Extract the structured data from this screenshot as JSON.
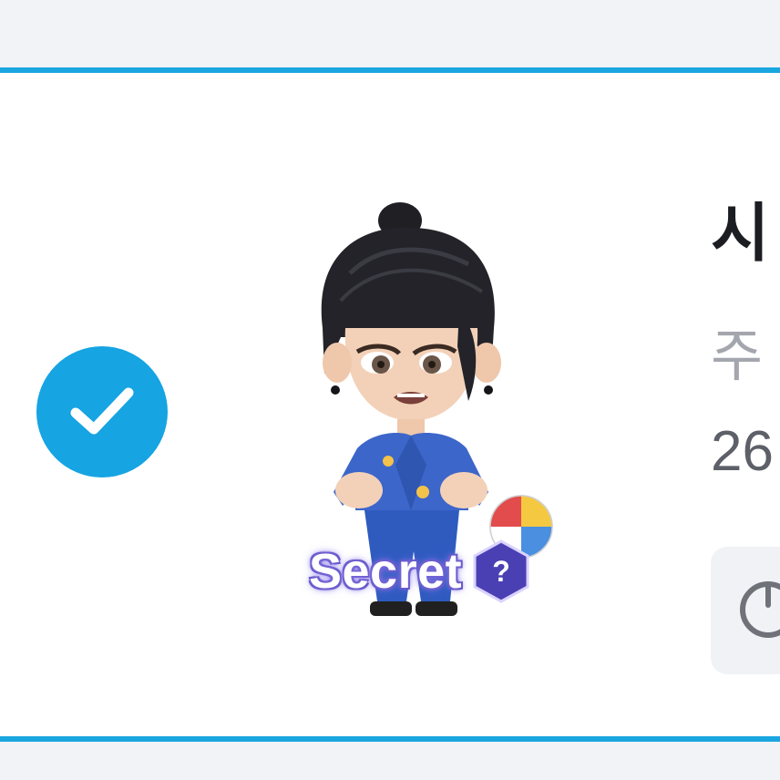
{
  "item": {
    "title": "시",
    "subtitle": "주",
    "price": "26",
    "badge_text": "Secret",
    "badge_symbol": "?",
    "selected": true
  },
  "icons": {
    "check": "check-icon",
    "question": "question-hexagon-icon",
    "action": "power-icon"
  },
  "colors": {
    "accent": "#1aa6e0",
    "check_fill": "#16a4e2",
    "badge_purple": "#4a3fb3"
  }
}
